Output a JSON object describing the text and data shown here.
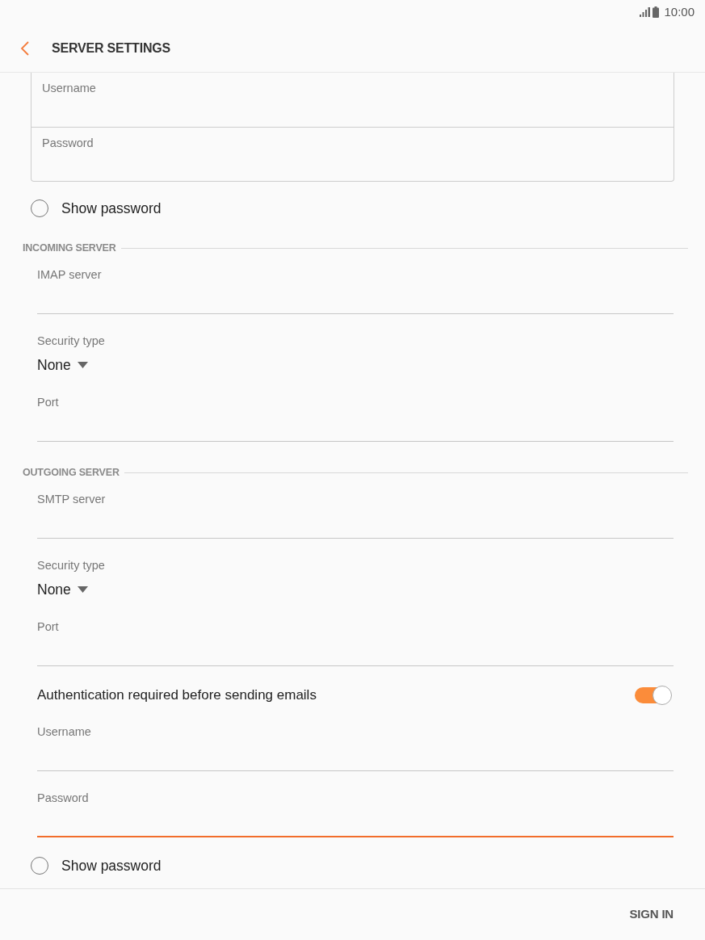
{
  "status_bar": {
    "time": "10:00"
  },
  "app_bar": {
    "title": "SERVER SETTINGS"
  },
  "account": {
    "fields": [
      {
        "label": "Username"
      },
      {
        "label": "Password"
      }
    ],
    "show_password": {
      "label": "Show password",
      "checked": false
    }
  },
  "sections": [
    {
      "title": "INCOMING SERVER",
      "items": [
        {
          "kind": "text",
          "label": "IMAP server",
          "focused": false
        },
        {
          "kind": "select",
          "label": "Security type",
          "value": "None"
        },
        {
          "kind": "text",
          "label": "Port",
          "focused": false
        }
      ]
    },
    {
      "title": "OUTGOING SERVER",
      "items": [
        {
          "kind": "text",
          "label": "SMTP server",
          "focused": false
        },
        {
          "kind": "select",
          "label": "Security type",
          "value": "None"
        },
        {
          "kind": "text",
          "label": "Port",
          "focused": false
        },
        {
          "kind": "switch",
          "label": "Authentication required before sending emails",
          "on": true
        },
        {
          "kind": "text",
          "label": "Username",
          "focused": false
        },
        {
          "kind": "text",
          "label": "Password",
          "focused": true
        },
        {
          "kind": "radio",
          "label": "Show password",
          "checked": false
        }
      ]
    }
  ],
  "footer": {
    "button": "SIGN IN"
  }
}
